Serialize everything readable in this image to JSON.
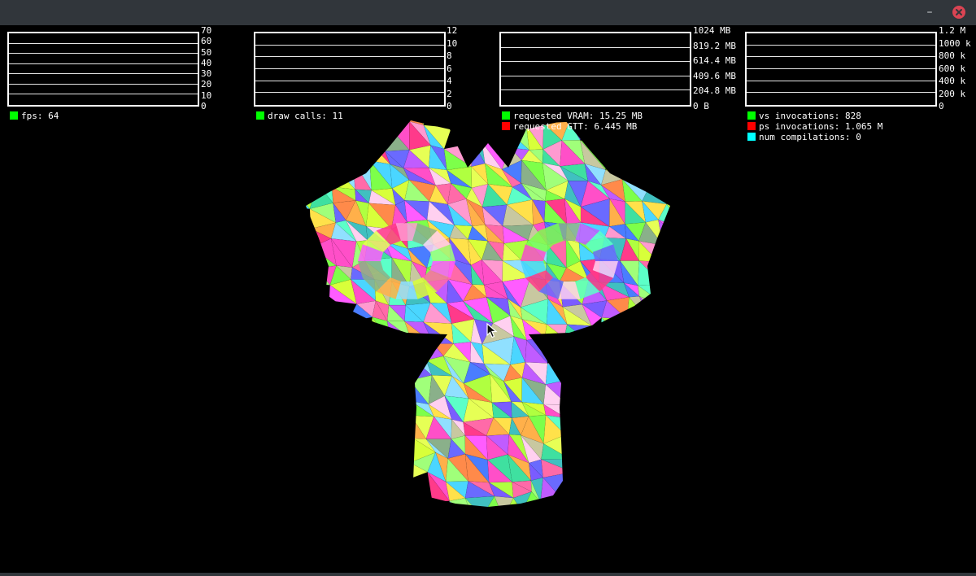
{
  "window": {
    "minimize_glyph": "–",
    "close_icon": "close-icon"
  },
  "hud": {
    "graphs": [
      {
        "id": "fps",
        "ticks": [
          "70",
          "60",
          "50",
          "40",
          "30",
          "20",
          "10",
          "0"
        ],
        "legend": [
          {
            "label": "fps: 64",
            "color": "#00ff00"
          }
        ]
      },
      {
        "id": "draw-calls",
        "ticks": [
          "12",
          "10",
          "8",
          "6",
          "4",
          "2",
          "0"
        ],
        "legend": [
          {
            "label": "draw calls: 11",
            "color": "#00ff00"
          }
        ]
      },
      {
        "id": "vram",
        "ticks": [
          "1024 MB",
          "819.2 MB",
          "614.4 MB",
          "409.6 MB",
          "204.8 MB",
          "0 B"
        ],
        "legend": [
          {
            "label": "requested VRAM: 15.25 MB",
            "color": "#00ff00"
          },
          {
            "label": "requested GTT: 6.445 MB",
            "color": "#ff0000"
          }
        ]
      },
      {
        "id": "invocations",
        "ticks": [
          "1.2 M",
          "1000 k",
          "800 k",
          "600 k",
          "400 k",
          "200 k",
          "0"
        ],
        "legend": [
          {
            "label": "vs invocations: 828",
            "color": "#00ff00"
          },
          {
            "label": "ps invocations: 1.065 M",
            "color": "#ff0000"
          },
          {
            "label": "num compilations: 0",
            "color": "#00ffff"
          }
        ]
      }
    ]
  },
  "scene": {
    "object": "low-poly-monkey-head-mesh",
    "cursor_icon": "mouse-pointer-icon"
  }
}
